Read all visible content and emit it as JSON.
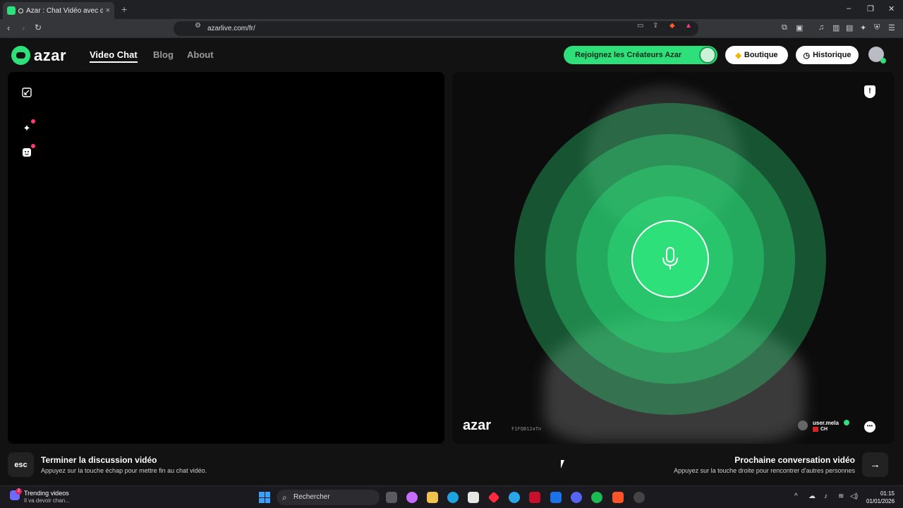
{
  "browser": {
    "tab_title": "Azar : Chat Vidéo avec de no",
    "tab_close": "×",
    "new_tab": "+",
    "url": "azarlive.com/fr/",
    "window_controls": [
      "–",
      "❐",
      "✕"
    ]
  },
  "site": {
    "logo_text": "azar",
    "nav": [
      "Video Chat",
      "Blog",
      "About"
    ],
    "creators_cta": "Rejoignez les Créateurs Azar",
    "shop_label": "Boutique",
    "history_label": "Historique"
  },
  "video": {
    "watermark": "azar",
    "watermark_id": "F1FQB12aTn",
    "user_name": "user.mela",
    "user_country": "CH",
    "accent": "#2ee07a"
  },
  "hints": {
    "esc_key": "esc",
    "end_title": "Terminer la discussion vidéo",
    "end_sub": "Appuyez sur la touche échap pour mettre fin au chat vidéo.",
    "next_title": "Prochaine conversation vidéo",
    "next_sub": "Appuyez sur la touche droite pour rencontrer d'autres personnes",
    "next_arrow": "→"
  },
  "taskbar": {
    "widget_badge": "2",
    "news_title": "Trending videos",
    "news_sub": "Il va devoir chan...",
    "search_placeholder": "Rechercher",
    "time": "01:15",
    "date": "01/01/2026"
  }
}
